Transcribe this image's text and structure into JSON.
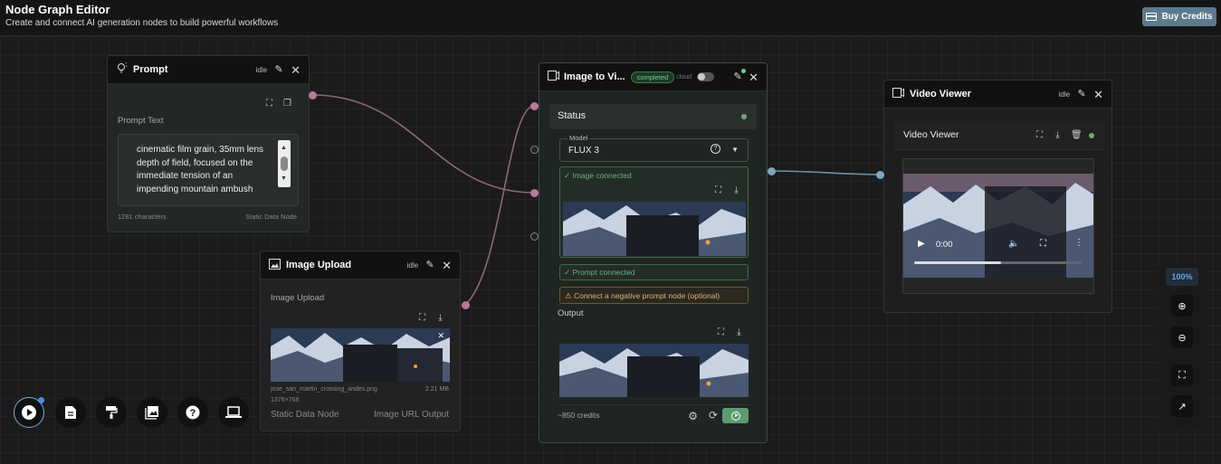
{
  "app": {
    "title": "Node Graph Editor",
    "subtitle": "Create and connect AI generation nodes to build powerful workflows",
    "buy_credits": "Buy Credits"
  },
  "prompt_node": {
    "title": "Prompt",
    "status": "idle",
    "field_label": "Prompt Text",
    "text": "cinematic film grain, 35mm lens depth of field, focused on the immediate tension of an impending mountain ambush",
    "char_count": "1281 characters",
    "node_type": "Static Data Node"
  },
  "upload_node": {
    "title": "Image Upload",
    "status": "idle",
    "field_label": "Image Upload",
    "filename": "jose_san_martin_crossing_andes.png",
    "filesize": "2.21 MB",
    "dimensions": "1376×768",
    "node_type": "Static Data Node",
    "output_type": "Image URL Output"
  },
  "i2v_node": {
    "title": "Image to Vi...",
    "badge": "completed",
    "cloud_label": "cloud",
    "status_label": "Status",
    "model_label": "Model",
    "model_value": "FLUX 3",
    "image_connected": "✓ Image connected",
    "prompt_connected": "✓ Prompt connected",
    "negative_warning": "⚠ Connect a negative prompt node (optional)",
    "output_label": "Output",
    "credits": "~850 credits"
  },
  "video_node": {
    "title": "Video Viewer",
    "status": "idle",
    "inner_title": "Video Viewer",
    "time": "0:00",
    "progress": 0.52
  },
  "zoom": {
    "level": "100%"
  },
  "colors": {
    "accent": "#5d7a8c",
    "port_pink": "#b87a9a",
    "port_blue": "#7ea6bf",
    "status_green": "#6fcf86",
    "edge_pink": "#8a6878",
    "edge_blue": "#6d8fa6"
  }
}
